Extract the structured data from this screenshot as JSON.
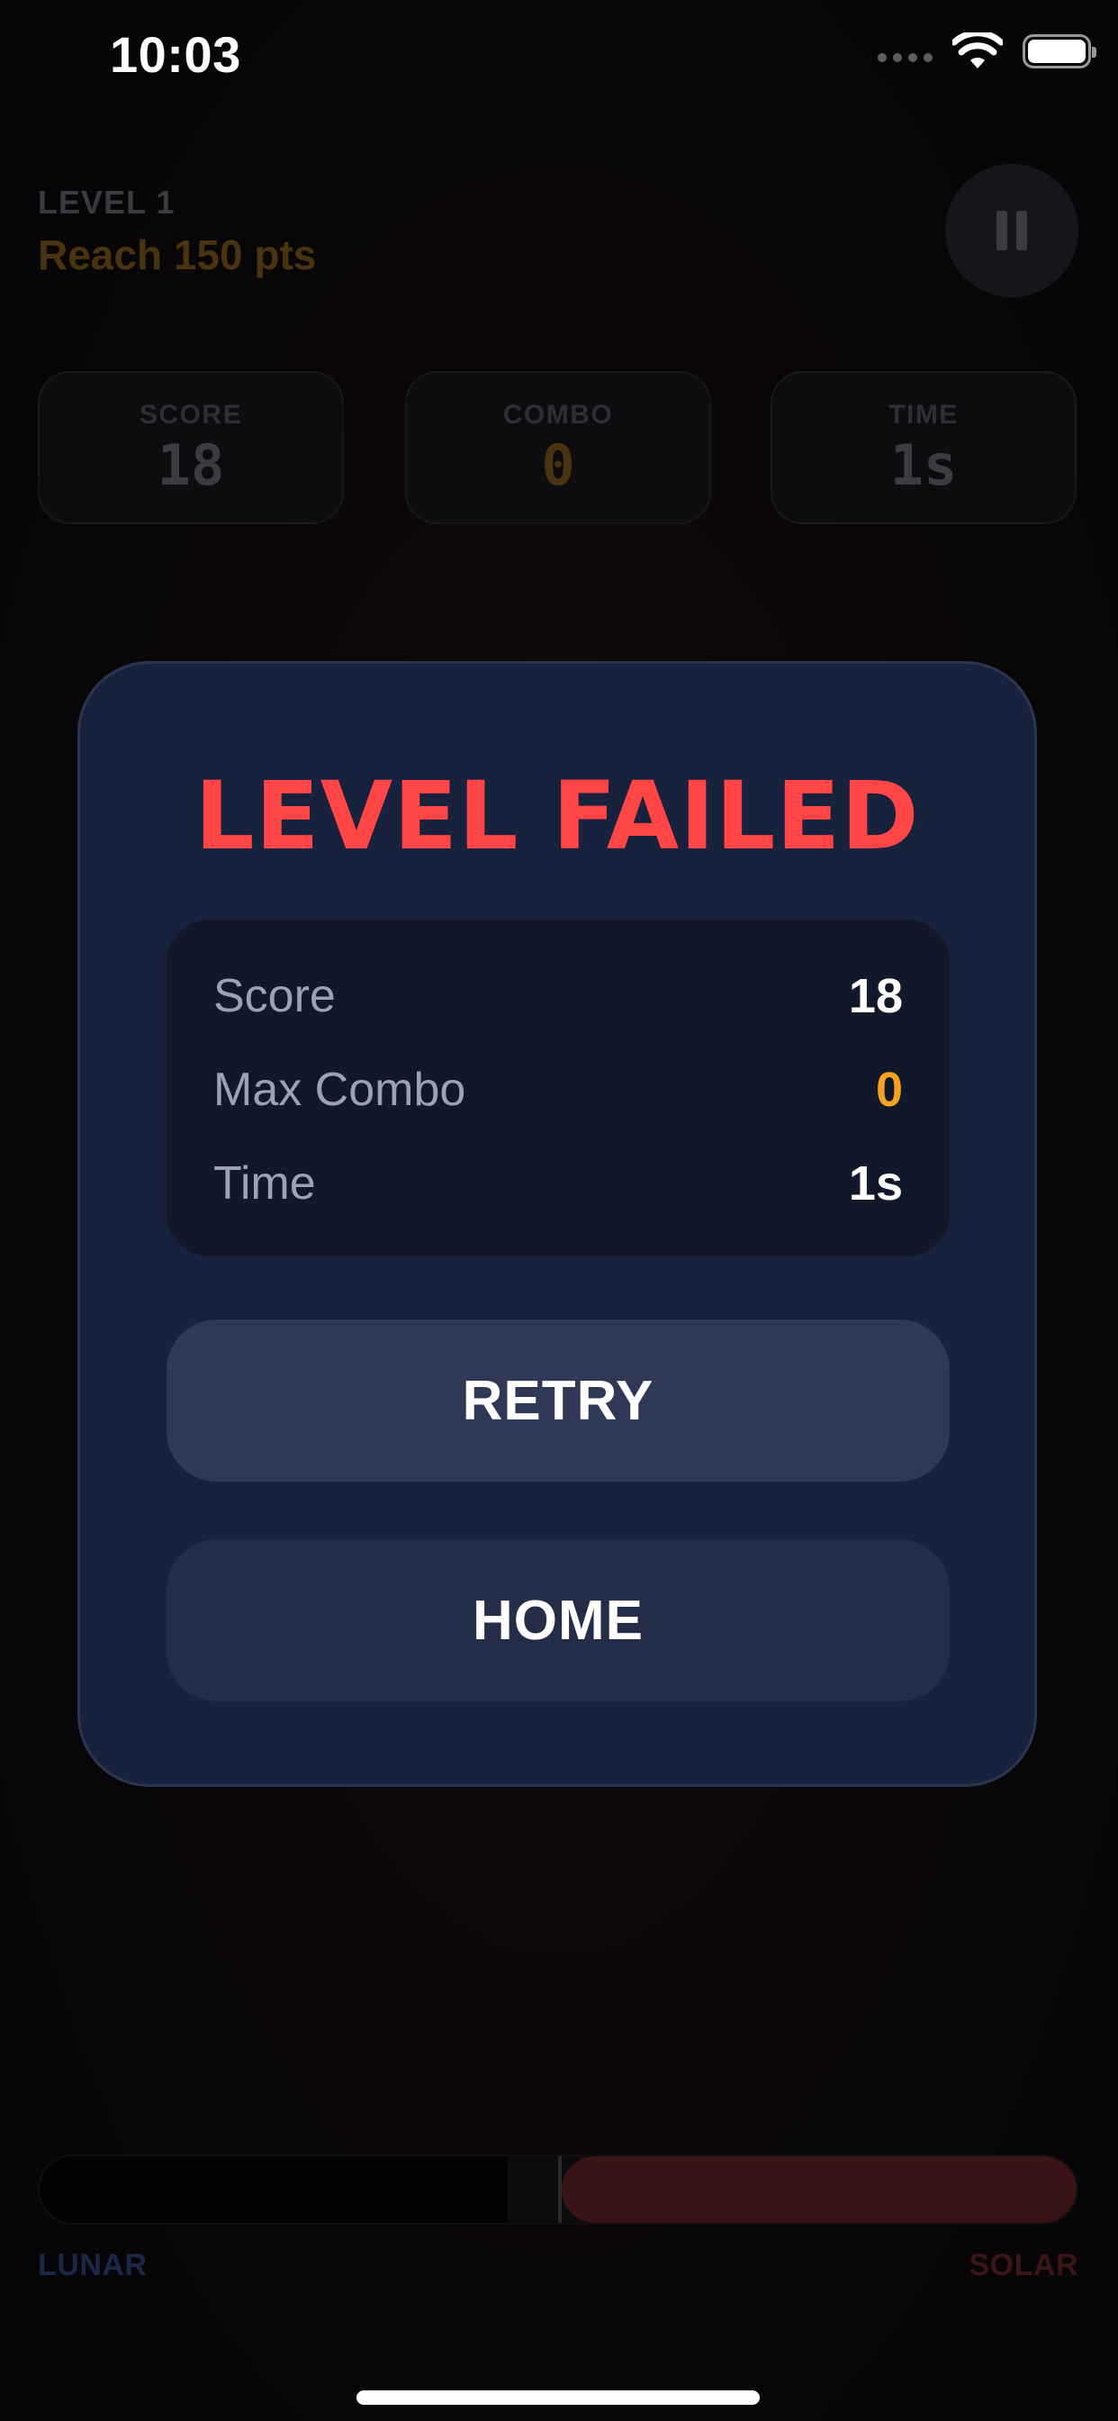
{
  "status_bar": {
    "time": "10:03",
    "icons": [
      "cellular-signal-icon",
      "wifi-icon",
      "battery-icon"
    ]
  },
  "game": {
    "level_label": "LEVEL 1",
    "goal": "Reach 150 pts",
    "stats": [
      {
        "label": "SCORE",
        "value": "18"
      },
      {
        "label": "COMBO",
        "value": "0"
      },
      {
        "label": "TIME",
        "value": "1s"
      }
    ],
    "balance": {
      "left_label": "LUNAR",
      "right_label": "SOLAR",
      "solar_fraction": 0.5
    }
  },
  "modal": {
    "title": "LEVEL FAILED",
    "results": [
      {
        "label": "Score",
        "value": "18"
      },
      {
        "label": "Max Combo",
        "value": "0"
      },
      {
        "label": "Time",
        "value": "1s"
      }
    ],
    "retry_label": "RETRY",
    "home_label": "HOME"
  },
  "colors": {
    "title_red": "#ff4545",
    "combo_orange": "#f4a21f",
    "modal_bg": "#18223d"
  }
}
